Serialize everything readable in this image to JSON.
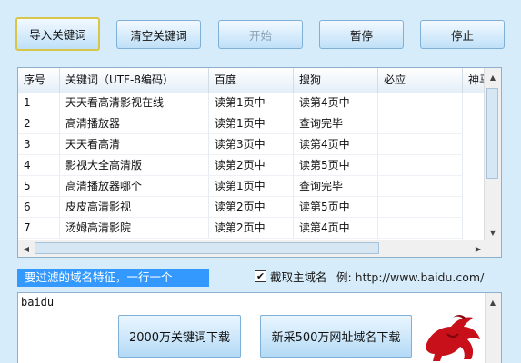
{
  "toolbar": {
    "import_label": "导入关键词",
    "clear_label": "清空关键词",
    "start_label": "开始",
    "pause_label": "暂停",
    "stop_label": "停止"
  },
  "grid": {
    "headers": [
      "序号",
      "关键词（UTF-8编码）",
      "百度",
      "搜狗",
      "必应",
      "神马"
    ],
    "rows": [
      [
        "1",
        "天天看高清影视在线",
        "读第1页中",
        "读第4页中"
      ],
      [
        "2",
        "高清播放器",
        "读第1页中",
        "查询完毕"
      ],
      [
        "3",
        "天天看高清",
        "读第3页中",
        "读第4页中"
      ],
      [
        "4",
        "影视大全高清版",
        "读第2页中",
        "读第5页中"
      ],
      [
        "5",
        "高清播放器哪个",
        "读第1页中",
        "查询完毕"
      ],
      [
        "6",
        "皮皮高清影视",
        "读第2页中",
        "读第5页中"
      ],
      [
        "7",
        "汤姆高清影院",
        "读第2页中",
        "读第4页中"
      ]
    ]
  },
  "filter": {
    "label": "要过滤的域名特征，一行一个",
    "checkbox_label": "截取主域名",
    "checkbox_checked": true,
    "example": "例: http://www.baidu.com/",
    "text": "baidu"
  },
  "downloads": {
    "keywords_label": "2000万关键词下载",
    "domains_label": "新采500万网址域名下载"
  },
  "icons": {
    "logo": "red-bull-logo-icon"
  }
}
